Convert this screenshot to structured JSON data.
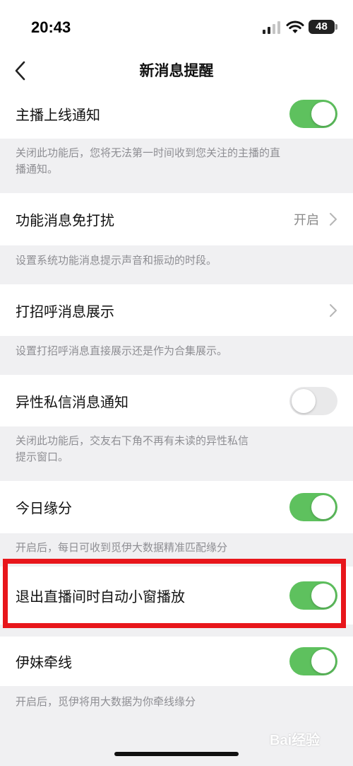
{
  "status_bar": {
    "time": "20:43",
    "battery": "48"
  },
  "nav": {
    "title": "新消息提醒"
  },
  "settings": [
    {
      "label": "主播上线通知",
      "control": "toggle",
      "on": true,
      "desc_lines": [
        "关闭此功能后，您将无法第一时间收到您关注的主播的直",
        "播通知。"
      ]
    },
    {
      "label": "功能消息免打扰",
      "control": "link",
      "value": "开启",
      "desc_lines": [
        "设置系统功能消息提示声音和振动的时段。"
      ]
    },
    {
      "label": "打招呼消息展示",
      "control": "link",
      "desc_lines": [
        "设置打招呼消息直接展示还是作为合集展示。"
      ]
    },
    {
      "label": "异性私信消息通知",
      "control": "toggle",
      "on": false,
      "desc_lines": [
        "关闭此功能后，交友右下角不再有未读的异性私信",
        "提示窗口。"
      ]
    },
    {
      "label": "今日缘分",
      "control": "toggle",
      "on": true,
      "desc_lines": [
        "开启后，每日可收到觅伊大数据精准匹配缘分"
      ]
    },
    {
      "label": "退出直播间时自动小窗播放",
      "control": "toggle",
      "on": true,
      "highlighted": true
    },
    {
      "label": "伊妹牵线",
      "control": "toggle",
      "on": true,
      "desc_lines": [
        "开启后，觅伊将用大数据为你牵线缘分"
      ]
    }
  ],
  "watermark": "Bai经验",
  "colors": {
    "toggle_on": "#5ec15e",
    "toggle_off": "#e9e9ea",
    "highlight": "#e8161b",
    "background": "#f0f0f2"
  }
}
